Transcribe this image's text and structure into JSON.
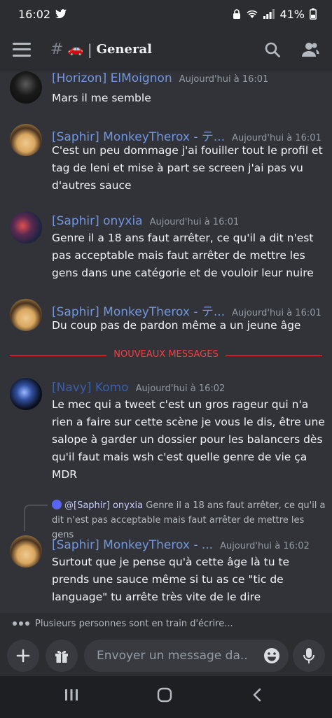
{
  "status_bar": {
    "time": "16:02",
    "battery": "41%"
  },
  "channel": {
    "emoji": "🚗",
    "name": "General"
  },
  "messages": [
    {
      "author": "[Horizon] ElMoignon",
      "timestamp": "Aujourd'hui à 16:01",
      "text": "Mars il me semble"
    },
    {
      "author": "[Saphir] MonkeyTherox - テ...",
      "timestamp": "Aujourd'hui à 16:01",
      "text": "C'est un peu dommage j'ai fouiller tout le profil et tag de leni et mise à part se screen j'ai pas vu d'autres sauce"
    },
    {
      "author": "[Saphir] onyxia",
      "timestamp": "Aujourd'hui à 16:01",
      "text": "Genre il a 18 ans faut arrêter, ce qu'il a dit n'est pas acceptable mais faut arrêter de mettre les gens dans une catégorie et de vouloir leur nuire"
    },
    {
      "author": "[Saphir] MonkeyTherox - テ...",
      "timestamp": "Aujourd'hui à 16:01",
      "text": "Du coup pas de pardon même a un jeune âge"
    },
    {
      "author": "[Navy] Komo",
      "timestamp": "Aujourd'hui à 16:02",
      "text": "Le mec qui a tweet c'est un gros rageur qui n'a rien a faire sur cette scène je vous le dis, être une salope à garder un dossier pour les balancers dès qu'il faut mais wsh c'est quelle genre de vie ça MDR"
    },
    {
      "author": "[Saphir] MonkeyTherox - ...",
      "timestamp": "Aujourd'hui à 16:02",
      "text": "Surtout que je pense qu'à cette âge là tu te prends une sauce même si tu as ce \"tic de language\" tu arrête très vite de le dire"
    }
  ],
  "divider": {
    "label": "NOUVEAUX MESSAGES"
  },
  "reply": {
    "mention": "@[Saphir] onyxia",
    "text": "Genre il a 18 ans faut arrêter, ce qu'il a dit n'est pas acceptable mais faut arrêter de mettre les gens"
  },
  "typing": {
    "text": "Plusieurs personnes sont en train d'écrire..."
  },
  "composer": {
    "placeholder": "Envoyer un message da..."
  },
  "icons": {
    "menu": "menu-icon",
    "search": "search-icon",
    "members": "members-icon",
    "add": "plus-icon",
    "gift": "gift-icon",
    "emoji": "emoji-icon",
    "mic": "microphone-icon"
  },
  "colors": {
    "accent": "#f23f43",
    "author": "#7196e0",
    "background": "#313338"
  }
}
